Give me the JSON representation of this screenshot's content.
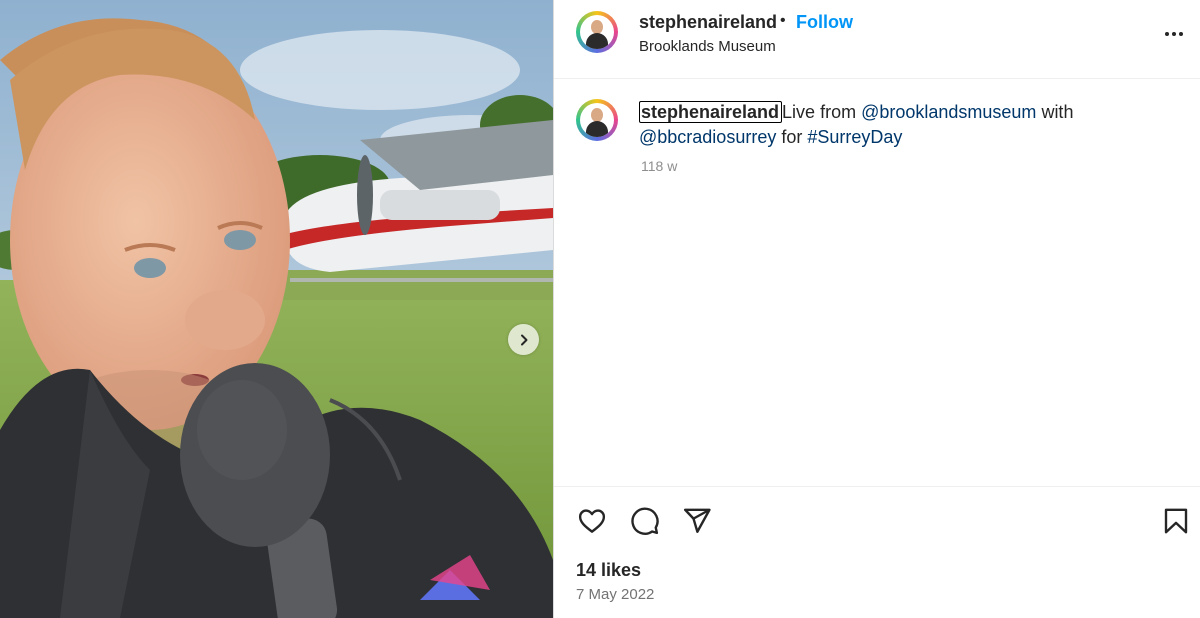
{
  "post": {
    "username": "stephenaireland",
    "separator": "•",
    "follow_label": "Follow",
    "location": "Brooklands Museum",
    "more_icon": "more-horizontal-icon",
    "next_icon": "chevron-right-icon"
  },
  "caption": {
    "username": "stephenaireland",
    "text_1": "Live from ",
    "mention_1": "@brooklandsmuseum",
    "text_2": " with ",
    "mention_2": "@bbcradiosurrey",
    "text_3": " for ",
    "hashtag": "#SurreyDay",
    "time_ago": "118 w"
  },
  "actions": {
    "like_icon": "heart-icon",
    "comment_icon": "comment-icon",
    "share_icon": "share-icon",
    "save_icon": "bookmark-icon"
  },
  "stats": {
    "likes": "14 likes",
    "date": "7 May 2022"
  },
  "colors": {
    "accent": "#0095f6",
    "link": "#00376b",
    "text": "#262626",
    "muted": "#8e8e8e"
  }
}
